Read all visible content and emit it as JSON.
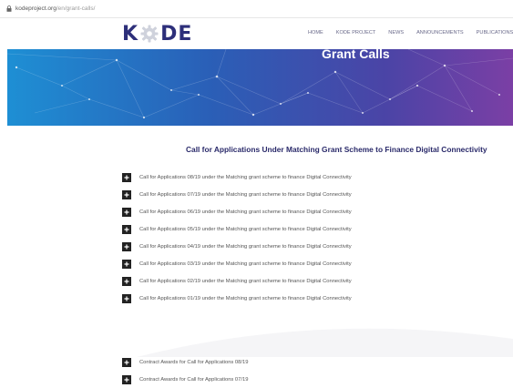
{
  "browser": {
    "url_domain": "kodeproject.org",
    "url_path": "/en/grant-calls/"
  },
  "site": {
    "logo_left": "K",
    "logo_right": "DE",
    "nav": [
      "HOME",
      "KODE PROJECT",
      "NEWS",
      "ANNOUNCEMENTS",
      "PUBLICATIONS"
    ]
  },
  "hero": {
    "title": "Grant Calls"
  },
  "section": {
    "title": "Call for Applications Under Matching Grant Scheme to Finance Digital Connectivity",
    "calls": [
      "Call for Applications 08/19 under the Matching grant scheme to finance Digital Connectivity",
      "Call for Applications 07/19 under the Matching grant scheme to finance Digital Connectivity",
      "Call for Applications 06/19 under the Matching grant scheme to finance Digital Connectivity",
      "Call for Applications 05/19 under the Matching grant scheme to finance Digital Connectivity",
      "Call for Applications 04/19 under the Matching grant scheme to finance Digital Connectivity",
      "Call for Applications 03/19 under the Matching grant scheme to finance Digital Connectivity",
      "Call for Applications 02/19 under the Matching grant scheme to finance Digital Connectivity",
      "Call for Applications 01/19 under the Matching grant scheme to finance Digital Connectivity"
    ]
  },
  "awards": [
    "Contract Awards for Call for Applications 08/19",
    "Contract Awards for Call for Applications 07/19"
  ],
  "colors": {
    "brand_navy": "#2d2f7a",
    "hero_start": "#1e8fd4",
    "hero_end": "#7b3fa5",
    "toggle_bg": "#222222"
  },
  "icons": {
    "address": "lock-icon",
    "logo": "gear-icon",
    "toggle": "plus-icon"
  }
}
